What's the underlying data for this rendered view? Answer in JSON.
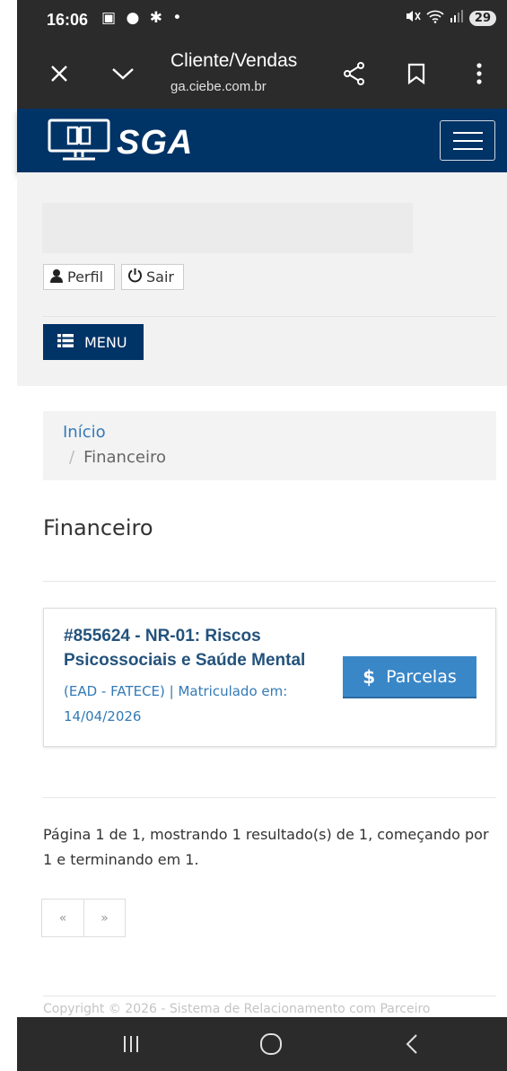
{
  "status_bar": {
    "time": "16:06",
    "left_icons": "▣ ● ✱ •",
    "battery": "29"
  },
  "browser": {
    "title": "Cliente/Vendas",
    "url": "ga.ciebe.com.br",
    "icons": [
      "close-icon",
      "chevron-down-icon",
      "share-icon",
      "bookmark-icon",
      "more-vert-icon"
    ]
  },
  "header": {
    "logo_text": "SGA"
  },
  "user": {
    "profile_label": "Perfil",
    "logout_label": "Sair",
    "menu_label": "MENU"
  },
  "breadcrumb": {
    "home": "Início",
    "separator": "/",
    "current": "Financeiro"
  },
  "page_title": "Financeiro",
  "course": {
    "title": "#855624 - NR-01: Riscos Psicossociais e Saúde Mental",
    "subtitle": "(EAD - FATECE) | Matriculado em: 14/04/2026",
    "button_symbol": "$",
    "button_label": "Parcelas"
  },
  "pagination": {
    "summary": "Página 1 de 1, mostrando 1 resultado(s) de 1, começando por 1 e terminando em 1.",
    "prev": "«",
    "next": "»"
  },
  "footer": {
    "copyright": "Copyright © 2026 - Sistema de Relacionamento com Parceiro"
  },
  "colors": {
    "brand": "#003366",
    "link": "#337ab7",
    "button": "#3a87c8"
  }
}
